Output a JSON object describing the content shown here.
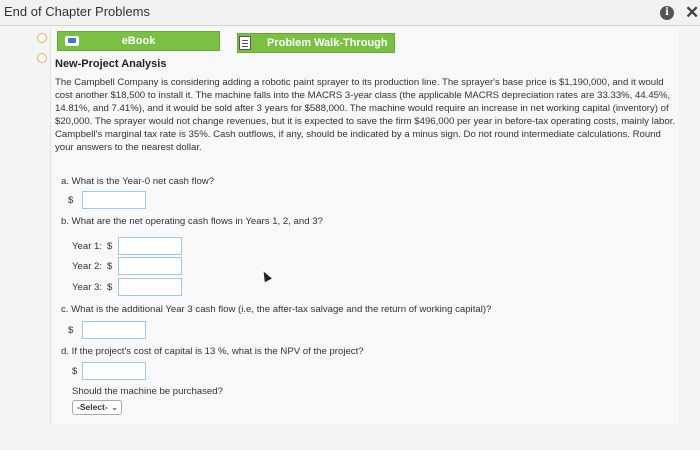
{
  "window": {
    "title": "End of Chapter Problems"
  },
  "toolbar": {
    "ebook_label": "eBook",
    "walkthrough_label": "Problem Walk-Through"
  },
  "problem": {
    "heading": "New-Project Analysis",
    "text": "The Campbell Company is considering adding a robotic paint sprayer to its production line. The sprayer's base price is $1,190,000, and it would cost another $18,500 to install it. The machine falls into the MACRS 3-year class (the applicable MACRS depreciation rates are 33.33%, 44.45%, 14.81%, and 7.41%), and it would be sold after 3 years for $588,000. The machine would require an increase in net working capital (inventory) of $20,000. The sprayer would not change revenues, but it is expected to save the firm $496,000 per year in before-tax operating costs, mainly labor. Campbell's marginal tax rate is 35%. Cash outflows, if any, should be indicated by a minus sign. Do not round intermediate calculations. Round your answers to the nearest dollar."
  },
  "questions": {
    "a": {
      "text": "a. What is the Year-0 net cash flow?",
      "currency": "$",
      "value": ""
    },
    "b": {
      "text": "b. What are the net operating cash flows in Years 1, 2, and 3?",
      "years": [
        {
          "label": "Year 1:",
          "currency": "$",
          "value": ""
        },
        {
          "label": "Year 2:",
          "currency": "$",
          "value": ""
        },
        {
          "label": "Year 3:",
          "currency": "$",
          "value": ""
        }
      ]
    },
    "c": {
      "text": "c. What is the additional Year 3 cash flow (i.e, the after-tax salvage and the return of working capital)?",
      "currency": "$",
      "value": ""
    },
    "d": {
      "text": "d. If the project's cost of capital is 13 %, what is the NPV of the project?",
      "currency": "$",
      "value": "",
      "purchase_question": "Should the machine be purchased?",
      "select_value": "-Select-"
    }
  },
  "icons": {
    "info": "info-icon",
    "close": "close-icon",
    "ebook": "ebook-icon",
    "walkthrough": "document-icon",
    "select_chevron": "chevron-down-icon"
  },
  "colors": {
    "button_green": "#7ac143",
    "input_border": "#9fc7e8",
    "radio_border": "#e2b24a"
  }
}
